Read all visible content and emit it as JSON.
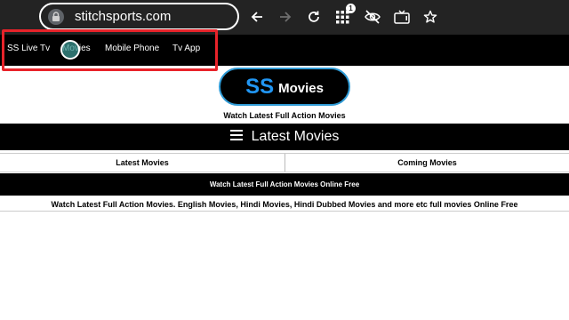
{
  "browser": {
    "url": "stitchsports.com",
    "extensions_badge": "1",
    "icons": [
      "lock-icon",
      "back-icon",
      "forward-icon",
      "reload-icon",
      "extensions-icon",
      "visibility-off-icon",
      "cast-tv-icon",
      "bookmark-star-icon"
    ]
  },
  "nav": {
    "items": [
      {
        "label": "SS Live Tv"
      },
      {
        "label": "Movies"
      },
      {
        "label": "Mobile Phone"
      },
      {
        "label": "Tv App"
      }
    ]
  },
  "logo": {
    "ss": "SS",
    "movies": "Movies"
  },
  "tagline": "Watch Latest Full Action Movies",
  "title_bar": {
    "title": "Latest Movies"
  },
  "tabs": [
    {
      "label": "Latest Movies"
    },
    {
      "label": "Coming Movies"
    }
  ],
  "subtitle": "Watch Latest Full Action Movies Online Free",
  "description": "Watch Latest Full Action Movies. English Movies, Hindi Movies, Hindi Dubbed Movies and more etc full movies Online Free",
  "colors": {
    "chrome_bg": "#232323",
    "accent_blue": "#2196f3",
    "logo_border": "#2f9bd6",
    "highlight_red": "#e8232a",
    "cursor_teal": "#3c9691"
  }
}
